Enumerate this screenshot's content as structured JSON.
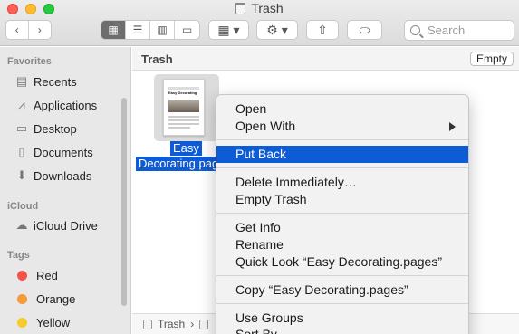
{
  "window": {
    "title": "Trash"
  },
  "toolbar": {
    "back_icon": "chevron-left-icon",
    "forward_icon": "chevron-right-icon",
    "view_modes": [
      "icon-view",
      "list-view",
      "column-view",
      "gallery-view"
    ],
    "active_view": "icon-view",
    "search_placeholder": "Search"
  },
  "sidebar": {
    "favorites_heading": "Favorites",
    "favorites": [
      {
        "label": "Recents",
        "icon": "recents-icon"
      },
      {
        "label": "Applications",
        "icon": "applications-icon"
      },
      {
        "label": "Desktop",
        "icon": "desktop-icon"
      },
      {
        "label": "Documents",
        "icon": "documents-icon"
      },
      {
        "label": "Downloads",
        "icon": "downloads-icon"
      }
    ],
    "icloud_heading": "iCloud",
    "icloud": [
      {
        "label": "iCloud Drive",
        "icon": "cloud-icon"
      }
    ],
    "tags_heading": "Tags",
    "tags": [
      {
        "label": "Red",
        "color": "#f2544c"
      },
      {
        "label": "Orange",
        "color": "#f59a34"
      },
      {
        "label": "Yellow",
        "color": "#f5cc2c"
      }
    ]
  },
  "content": {
    "location_label": "Trash",
    "empty_button": "Empty",
    "file": {
      "name_line1": "Easy",
      "name_line2": "Decorating.page",
      "thumb_title": "Easy Decorating"
    },
    "pathbar": {
      "item": "Trash"
    }
  },
  "context_menu": {
    "items": [
      {
        "label": "Open"
      },
      {
        "label": "Open With",
        "submenu": true
      },
      {
        "label": "Put Back",
        "highlighted": true
      },
      {
        "label": "Delete Immediately…"
      },
      {
        "label": "Empty Trash"
      },
      {
        "label": "Get Info"
      },
      {
        "label": "Rename"
      },
      {
        "label": "Quick Look “Easy Decorating.pages”"
      },
      {
        "label": "Copy “Easy Decorating.pages”"
      },
      {
        "label": "Use Groups"
      },
      {
        "label": "Sort By"
      }
    ]
  }
}
